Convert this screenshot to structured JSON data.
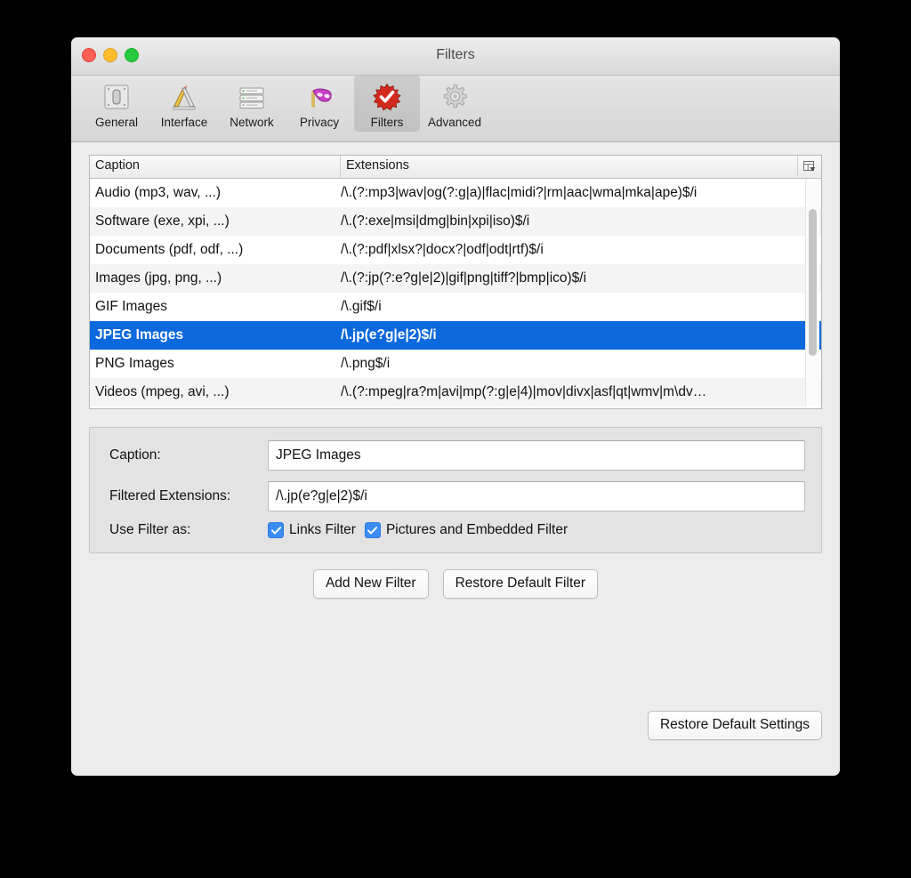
{
  "window": {
    "title": "Filters",
    "traffic_lights": [
      "close-button",
      "minimize-button",
      "zoom-button"
    ]
  },
  "toolbar": {
    "items": [
      {
        "label": "General",
        "icon": "general-icon",
        "selected": false
      },
      {
        "label": "Interface",
        "icon": "interface-icon",
        "selected": false
      },
      {
        "label": "Network",
        "icon": "network-icon",
        "selected": false
      },
      {
        "label": "Privacy",
        "icon": "privacy-icon",
        "selected": false
      },
      {
        "label": "Filters",
        "icon": "filters-icon",
        "selected": true
      },
      {
        "label": "Advanced",
        "icon": "advanced-icon",
        "selected": false
      }
    ]
  },
  "table": {
    "columns": [
      "Caption",
      "Extensions"
    ],
    "column_options_icon": "column-options-icon",
    "rows": [
      {
        "caption": "Audio (mp3, wav, ...)",
        "extensions": "/\\.(?:mp3|wav|og(?:g|a)|flac|midi?|rm|aac|wma|mka|ape)$/i",
        "selected": false
      },
      {
        "caption": "Software (exe, xpi, ...)",
        "extensions": "/\\.(?:exe|msi|dmg|bin|xpi|iso)$/i",
        "selected": false
      },
      {
        "caption": "Documents (pdf, odf, ...)",
        "extensions": "/\\.(?:pdf|xlsx?|docx?|odf|odt|rtf)$/i",
        "selected": false
      },
      {
        "caption": "Images (jpg, png, ...)",
        "extensions": "/\\.(?:jp(?:e?g|e|2)|gif|png|tiff?|bmp|ico)$/i",
        "selected": false
      },
      {
        "caption": "GIF Images",
        "extensions": "/\\.gif$/i",
        "selected": false
      },
      {
        "caption": "JPEG Images",
        "extensions": "/\\.jp(e?g|e|2)$/i",
        "selected": true
      },
      {
        "caption": "PNG Images",
        "extensions": "/\\.png$/i",
        "selected": false
      },
      {
        "caption": "Videos (mpeg, avi, ...)",
        "extensions": "/\\.(?:mpeg|ra?m|avi|mp(?:g|e|4)|mov|divx|asf|qt|wmv|m\\dv…",
        "selected": false
      }
    ]
  },
  "detail": {
    "caption_label": "Caption:",
    "caption_value": "JPEG Images",
    "extensions_label": "Filtered Extensions:",
    "extensions_value": "/\\.jp(e?g|e|2)$/i",
    "use_filter_label": "Use Filter as:",
    "checkboxes": [
      {
        "label": "Links Filter",
        "checked": true
      },
      {
        "label": "Pictures and Embedded Filter",
        "checked": true
      }
    ]
  },
  "buttons": {
    "add_new_filter": "Add New Filter",
    "restore_default_filter": "Restore Default Filter",
    "restore_default_settings": "Restore Default Settings"
  },
  "colors": {
    "selection_blue": "#0b68dd",
    "checkbox_blue": "#3b8cf4",
    "window_bg": "#ececec"
  }
}
